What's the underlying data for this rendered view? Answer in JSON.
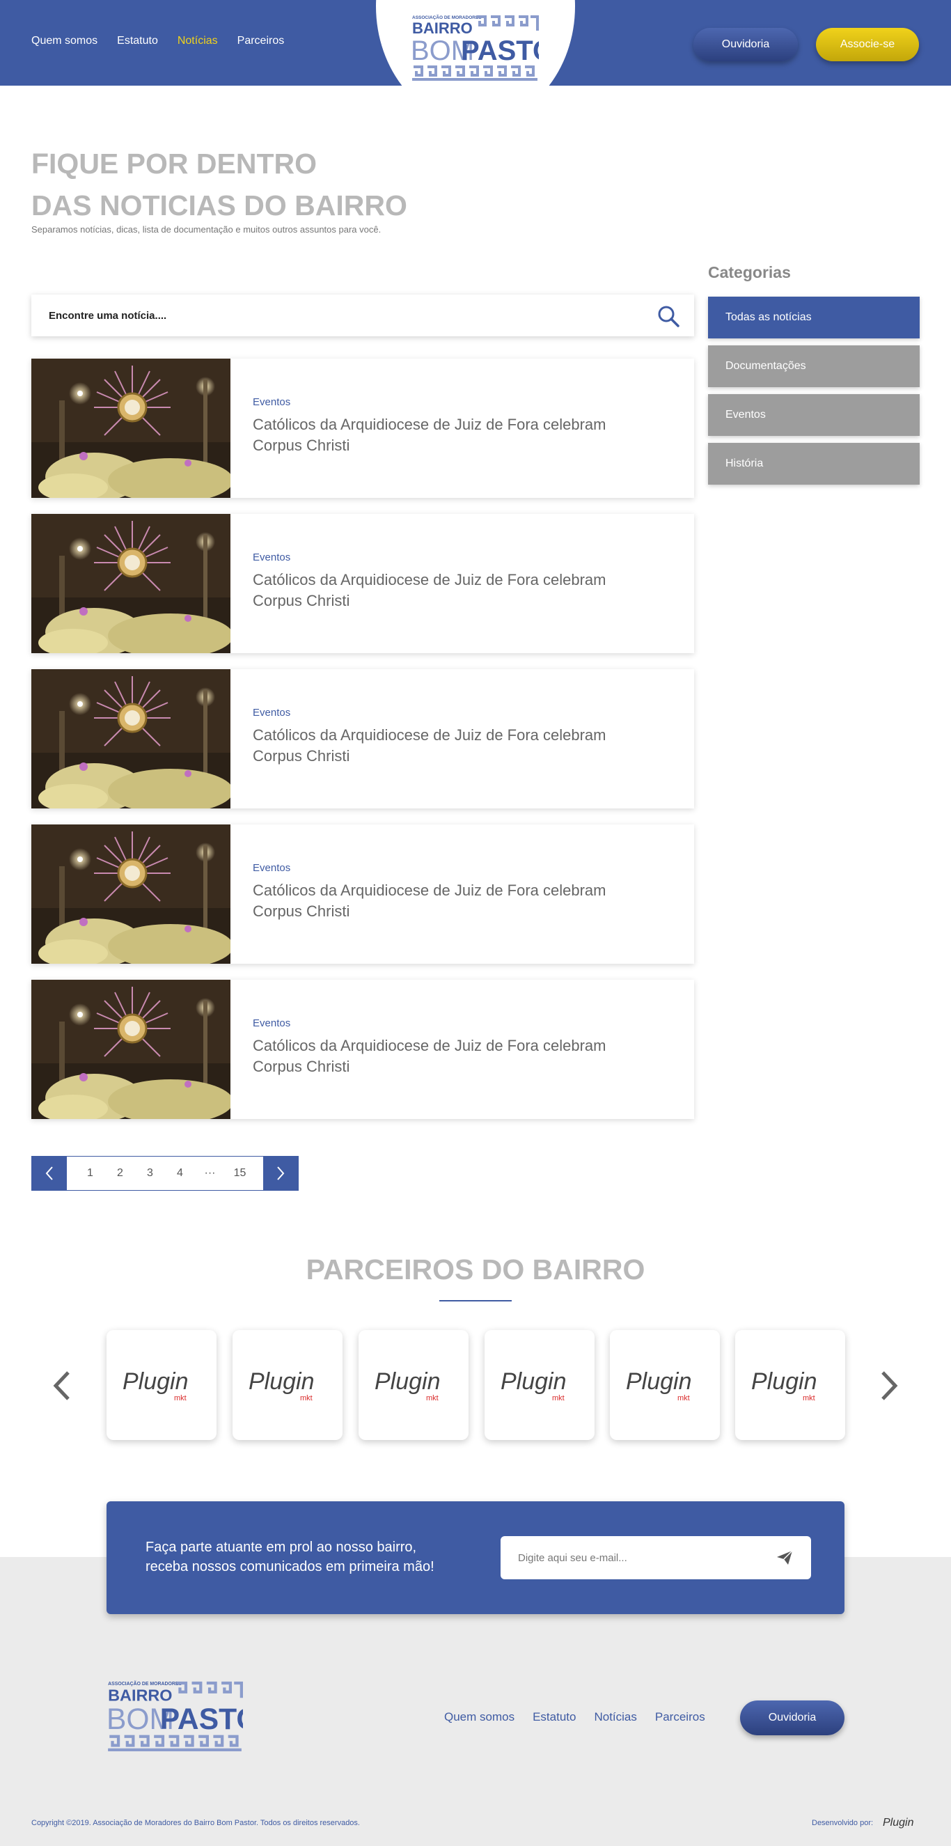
{
  "header": {
    "nav": [
      "Quem somos",
      "Estatuto",
      "Notícias",
      "Parceiros"
    ],
    "active_nav": "Notícias",
    "ouvidoria_label": "Ouvidoria",
    "associe_label": "Associe-se",
    "logo": {
      "top": "ASSOCIAÇÃO DE MORADORES",
      "line1": "BAIRRO",
      "line2a": "BOM",
      "line2b": "PASTOR"
    }
  },
  "hero": {
    "title_line1": "FIQUE POR DENTRO",
    "title_line2": "DAS NOTICIAS DO BAIRRO",
    "subtitle": "Separamos notícias, dicas, lista de documentação e muitos outros assuntos para você."
  },
  "search": {
    "placeholder": "Encontre uma notícia...."
  },
  "news": [
    {
      "category": "Eventos",
      "title": "Católicos da Arquidiocese de Juiz de Fora celebram Corpus Christi"
    },
    {
      "category": "Eventos",
      "title": "Católicos da Arquidiocese de Juiz de Fora celebram Corpus Christi"
    },
    {
      "category": "Eventos",
      "title": "Católicos da Arquidiocese de Juiz de Fora celebram Corpus Christi"
    },
    {
      "category": "Eventos",
      "title": "Católicos da Arquidiocese de Juiz de Fora celebram Corpus Christi"
    },
    {
      "category": "Eventos",
      "title": "Católicos da Arquidiocese de Juiz de Fora celebram Corpus Christi"
    }
  ],
  "sidebar": {
    "title": "Categorias",
    "items": [
      "Todas as notícias",
      "Documentações",
      "Eventos",
      "História"
    ]
  },
  "pagination": {
    "pages": [
      "1",
      "2",
      "3",
      "4",
      "···",
      "15"
    ]
  },
  "partners": {
    "title": "PARCEIROS DO BAIRRO",
    "logo_text": "Plugin",
    "logo_sub": "mkt"
  },
  "newsletter": {
    "text_line1": "Faça parte atuante em prol ao nosso bairro,",
    "text_line2": "receba nossos comunicados em primeira mão!",
    "placeholder": "Digite aqui seu e-mail..."
  },
  "footer": {
    "nav": [
      "Quem somos",
      "Estatuto",
      "Notícias",
      "Parceiros"
    ],
    "ouvidoria_label": "Ouvidoria",
    "copyright": "Copyright ©2019. Associação de Moradores do Bairro Bom Pastor. Todos os direitos reservados.",
    "developed_by": "Desenvolvido por:",
    "dev_logo": "Plugin"
  },
  "colors": {
    "primary": "#3f5ba3",
    "accent": "#f0d21b",
    "muted": "#9d9d9d"
  }
}
